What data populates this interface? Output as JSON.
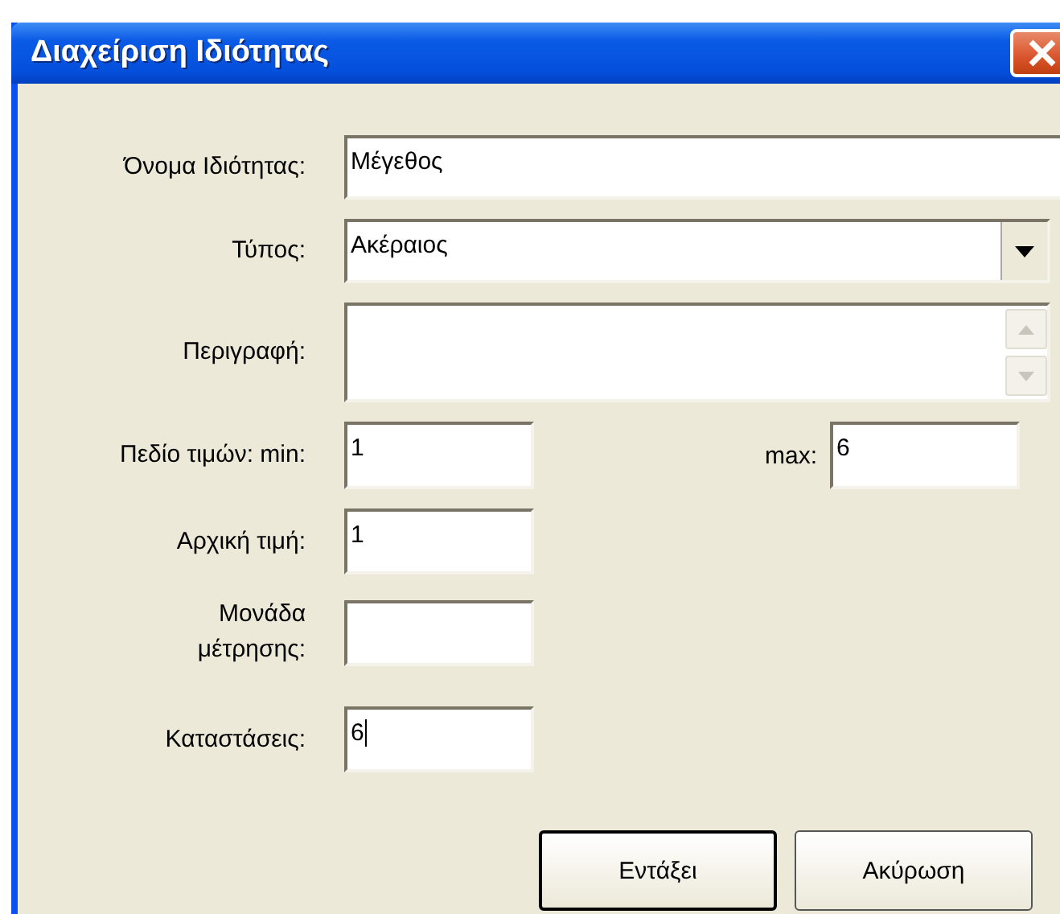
{
  "window": {
    "title": "Διαχείριση Ιδιότητας"
  },
  "fields": [
    {
      "kind": "text",
      "label": "Όνομα Ιδιότητας:",
      "value": "Μέγεθος"
    },
    {
      "kind": "dropdown",
      "label": "Τύπος:",
      "value": "Ακέραιος"
    },
    {
      "kind": "textarea",
      "label": "Περιγραφή:"
    },
    {
      "kind": "range",
      "label": "Πεδίο τιμών: min:",
      "value": "1",
      "max_label": "max:",
      "max_value": "6"
    },
    {
      "kind": "short",
      "label": "Αρχική τιμή:",
      "value": "1"
    },
    {
      "kind": "short",
      "label": "Μονάδα\nμέτρησης:"
    },
    {
      "kind": "short",
      "label": "Καταστάσεις:",
      "value": "6",
      "focused": true
    }
  ],
  "buttons": [
    {
      "label": "Εντάξει",
      "default": true
    },
    {
      "label": "Ακύρωση",
      "default": false
    }
  ]
}
